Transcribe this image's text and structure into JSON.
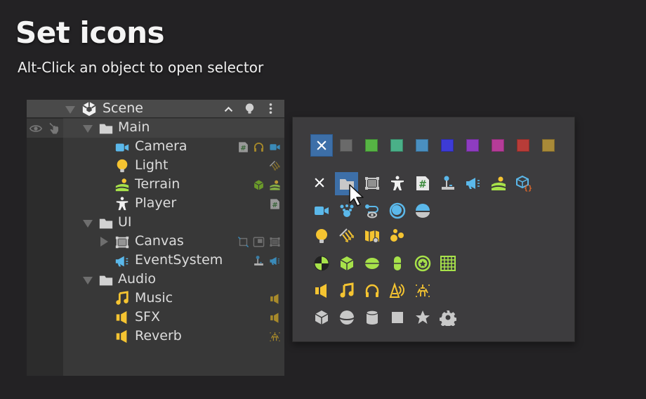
{
  "header": {
    "title": "Set icons",
    "subtitle": "Alt-Click an object to open selector"
  },
  "hierarchy": {
    "scene": {
      "label": "Scene",
      "icon": "unity-scene-icon",
      "actions": [
        "collapse-up-icon",
        "lightbulb-icon",
        "more-vertical-icon"
      ]
    },
    "gutter_icons": [
      "eye-icon",
      "pointer-hand-icon"
    ],
    "items": [
      {
        "label": "Main",
        "icon": "folder-icon",
        "expanded": true,
        "components": []
      },
      {
        "label": "Camera",
        "icon": "camera-icon",
        "components": [
          "script-icon",
          "headphones-icon",
          "camera-icon"
        ]
      },
      {
        "label": "Light",
        "icon": "light-bulb-icon",
        "components": [
          "directional-light-icon"
        ]
      },
      {
        "label": "Terrain",
        "icon": "terrain-icon",
        "components": [
          "cube-collider-icon",
          "terrain-icon"
        ]
      },
      {
        "label": "Player",
        "icon": "avatar-icon",
        "components": [
          "script-icon"
        ]
      },
      {
        "label": "UI",
        "icon": "folder-icon",
        "expanded": true,
        "components": []
      },
      {
        "label": "Canvas",
        "icon": "canvas-icon",
        "collapsed": true,
        "components": [
          "rect-transform-icon",
          "canvas-scaler-icon",
          "canvas-icon"
        ]
      },
      {
        "label": "EventSystem",
        "icon": "event-system-icon",
        "components": [
          "input-module-icon",
          "event-system-icon"
        ]
      },
      {
        "label": "Audio",
        "icon": "folder-icon",
        "expanded": true,
        "components": []
      },
      {
        "label": "Music",
        "icon": "music-note-icon",
        "components": [
          "audio-source-icon"
        ]
      },
      {
        "label": "SFX",
        "icon": "speaker-icon",
        "components": [
          "audio-source-icon"
        ]
      },
      {
        "label": "Reverb",
        "icon": "speaker-icon",
        "components": [
          "reverb-zone-icon"
        ]
      }
    ]
  },
  "selector": {
    "colors": [
      {
        "name": "none",
        "hex": "#3d6fa8",
        "selected": true
      },
      {
        "name": "gray",
        "hex": "#6a6a6a"
      },
      {
        "name": "green",
        "hex": "#56b444"
      },
      {
        "name": "teal",
        "hex": "#4ab088"
      },
      {
        "name": "blue",
        "hex": "#4a8fc0"
      },
      {
        "name": "indigo",
        "hex": "#3d3bd6"
      },
      {
        "name": "purple",
        "hex": "#8e3cc0"
      },
      {
        "name": "magenta",
        "hex": "#b63c98"
      },
      {
        "name": "red",
        "hex": "#b83c38"
      },
      {
        "name": "gold",
        "hex": "#a98a38"
      }
    ],
    "icon_rows": [
      [
        "none-icon",
        "folder-icon",
        "canvas-icon",
        "avatar-icon",
        "script-icon",
        "joystick-icon",
        "event-system-icon",
        "terrain-icon",
        "prefab-script-icon"
      ],
      [
        "camera-icon",
        "particles-icon",
        "navmesh-icon",
        "sphere-ring-icon",
        "hemisphere-icon"
      ],
      [
        "light-bulb-icon",
        "directional-light-icon",
        "lightmap-icon",
        "light-probes-icon"
      ],
      [
        "sphere-collider-icon",
        "box-collider-icon",
        "capsule-collider-icon",
        "capsule-vertical-icon",
        "wheel-collider-icon",
        "grid-icon"
      ],
      [
        "audio-source-icon",
        "music-note-icon",
        "headphones-icon",
        "audio-emitter-icon",
        "reverb-zone-icon"
      ],
      [
        "cube-icon",
        "sphere-icon",
        "cylinder-icon",
        "square-icon",
        "star-icon",
        "gear-icon"
      ]
    ],
    "selected_icon": "folder-icon"
  },
  "colors": {
    "blue_icon": "#5bb8ea",
    "yellow_icon": "#f5c431",
    "green_icon": "#a7e24a",
    "gray_icon": "#c8c8c8"
  }
}
